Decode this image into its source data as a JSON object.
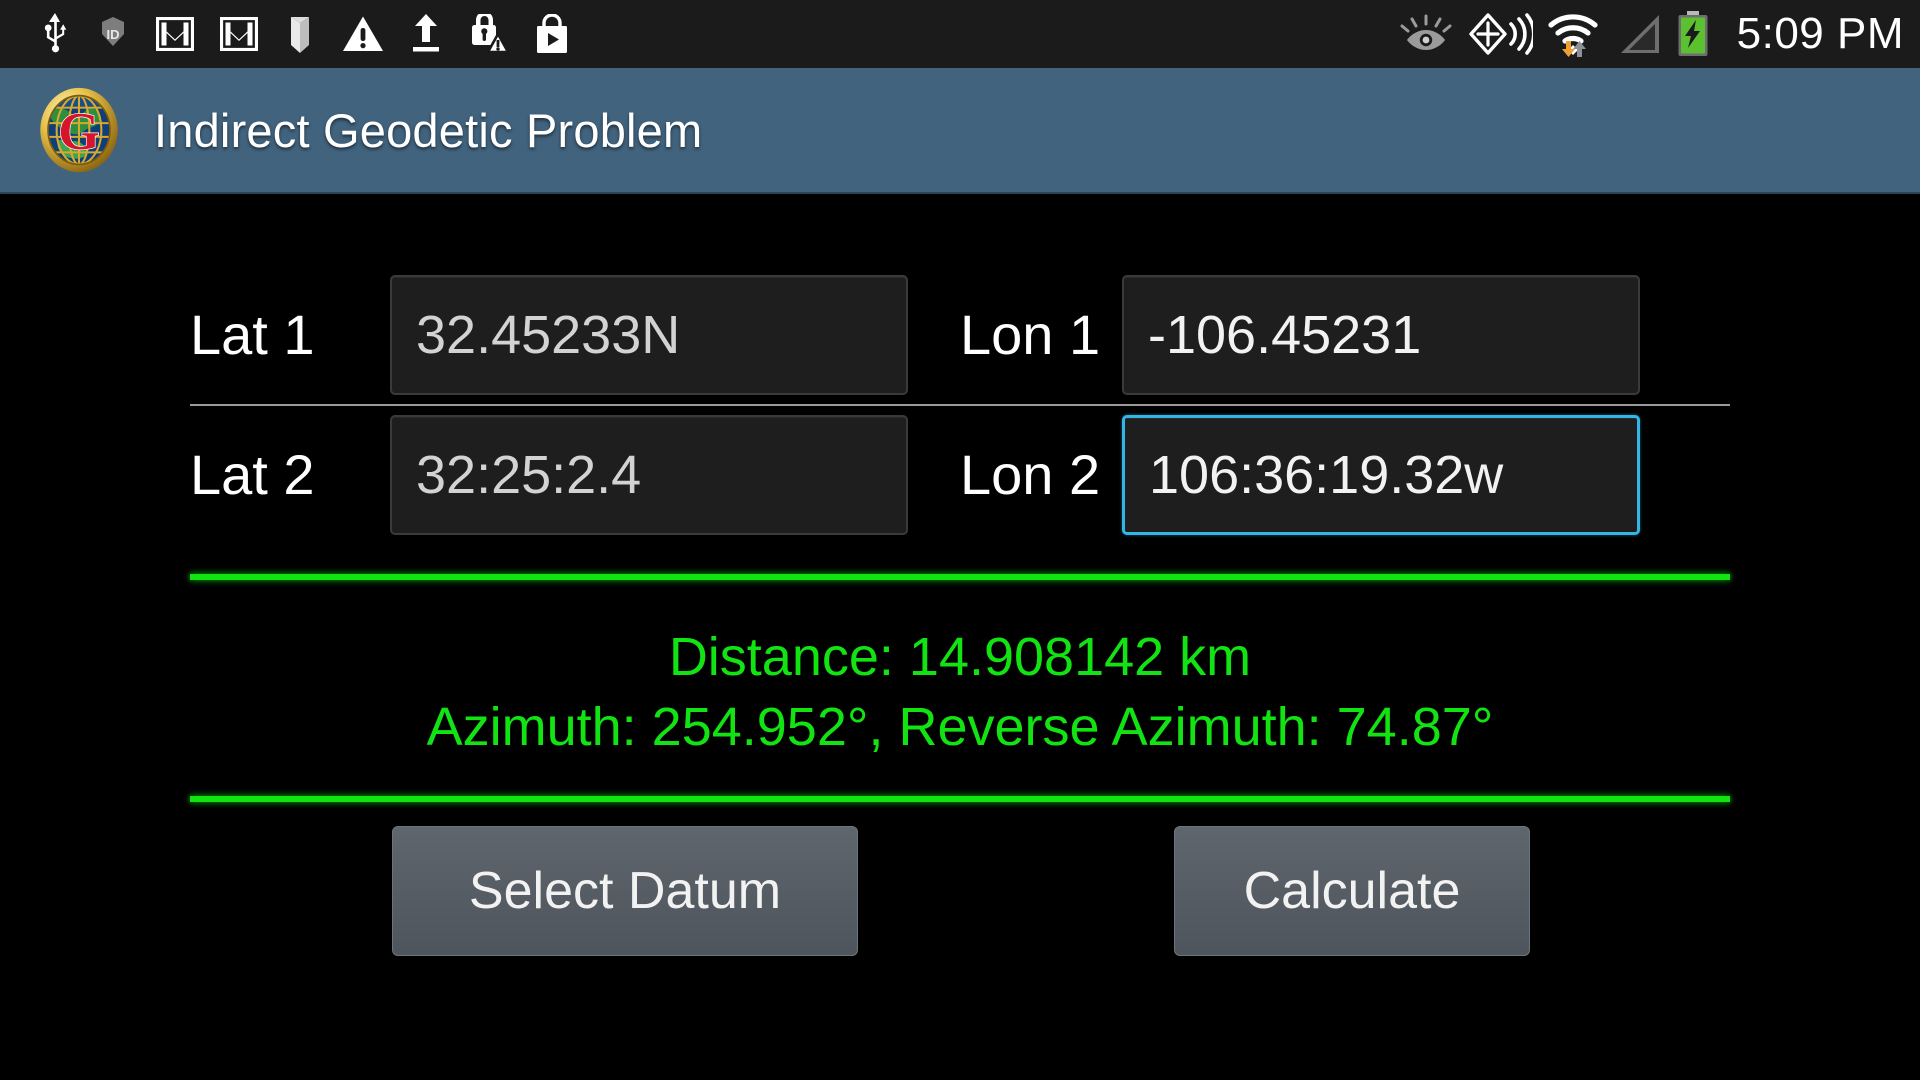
{
  "status_bar": {
    "time": "5:09 PM",
    "background": "#1b1b1b",
    "left_icons": [
      {
        "name": "usb-icon",
        "label": "USB"
      },
      {
        "name": "id-badge-icon",
        "label": "ID"
      },
      {
        "name": "gmail-icon",
        "label": "Gmail"
      },
      {
        "name": "gmail-icon-2",
        "label": "Gmail"
      },
      {
        "name": "book-icon",
        "label": "Book"
      },
      {
        "name": "warning-triangle-icon",
        "label": "Warning"
      },
      {
        "name": "upload-icon",
        "label": "Upload"
      },
      {
        "name": "lock-warning-icon",
        "label": "Lock warning"
      },
      {
        "name": "play-store-icon",
        "label": "Play Store"
      }
    ],
    "right_icons": [
      {
        "name": "eye-icon",
        "label": "Smart stay"
      },
      {
        "name": "gps-location-icon",
        "label": "GPS"
      },
      {
        "name": "wifi-icon",
        "label": "Wi-Fi"
      },
      {
        "name": "cellular-signal-icon",
        "label": "Signal"
      },
      {
        "name": "battery-charging-icon",
        "label": "Battery charging"
      }
    ]
  },
  "title_bar": {
    "title": "Indirect Geodetic Problem",
    "logo_name": "globe-g-logo",
    "background": "#41637e"
  },
  "form": {
    "rows": [
      {
        "left": {
          "label": "Lat 1",
          "value": "32.45233N",
          "focused": false,
          "name": "lat-1"
        },
        "right": {
          "label": "Lon 1",
          "value": "-106.45231",
          "focused": false,
          "name": "lon-1"
        }
      },
      {
        "left": {
          "label": "Lat 2",
          "value": "32:25:2.4",
          "focused": false,
          "name": "lat-2"
        },
        "right": {
          "label": "Lon 2",
          "value": "106:36:19.32w",
          "focused": true,
          "name": "lon-2"
        }
      }
    ]
  },
  "results": {
    "accent_color": "#12e312",
    "line1": "Distance: 14.908142 km",
    "line2": "Azimuth: 254.952°, Reverse Azimuth: 74.87°"
  },
  "buttons": {
    "select_datum": "Select Datum",
    "calculate": "Calculate",
    "background": "#565d64"
  }
}
